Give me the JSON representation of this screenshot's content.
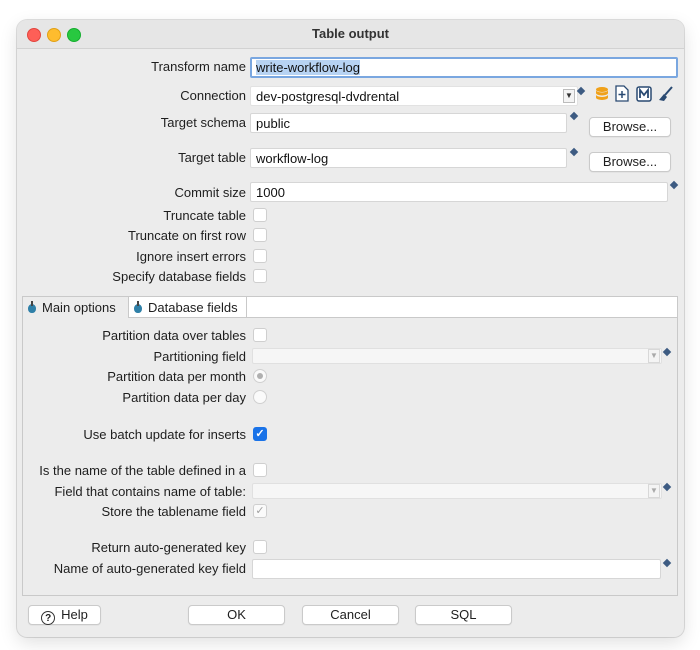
{
  "window": {
    "title": "Table output"
  },
  "top": {
    "transform_name": {
      "label": "Transform name",
      "value": "write-workflow-log"
    },
    "connection": {
      "label": "Connection",
      "value": "dev-postgresql-dvdrental"
    },
    "target_schema": {
      "label": "Target schema",
      "value": "public",
      "browse": "Browse..."
    },
    "target_table": {
      "label": "Target table",
      "value": "workflow-log",
      "browse": "Browse..."
    },
    "commit_size": {
      "label": "Commit size",
      "value": "1000"
    },
    "truncate_table": {
      "label": "Truncate table",
      "checked": false
    },
    "truncate_first_row": {
      "label": "Truncate on first row",
      "checked": false
    },
    "ignore_insert_errors": {
      "label": "Ignore insert errors",
      "checked": false
    },
    "specify_db_fields": {
      "label": "Specify database fields",
      "checked": false
    }
  },
  "tabs": [
    {
      "label": "Main options",
      "active": true
    },
    {
      "label": "Database fields",
      "active": false
    }
  ],
  "main_options": {
    "partition_over_tables": {
      "label": "Partition data over tables",
      "checked": false
    },
    "partitioning_field": {
      "label": "Partitioning field",
      "value": ""
    },
    "partition_per_month": {
      "label": "Partition data per month",
      "selected": true
    },
    "partition_per_day": {
      "label": "Partition data per day",
      "selected": false
    },
    "use_batch_update": {
      "label": "Use batch update for inserts",
      "checked": true
    },
    "table_name_in_field": {
      "label": "Is the name of the table defined in a",
      "checked": false
    },
    "field_with_table_name": {
      "label": "Field that contains name of table:",
      "value": ""
    },
    "store_tablename_field": {
      "label": "Store the tablename field",
      "checked": true
    },
    "return_auto_key": {
      "label": "Return auto-generated key",
      "checked": false
    },
    "auto_key_field_name": {
      "label": "Name of auto-generated key field",
      "value": ""
    }
  },
  "buttons": {
    "help": "Help",
    "ok": "OK",
    "cancel": "Cancel",
    "sql": "SQL"
  },
  "colors": {
    "accent": "#1a73e8",
    "selection": "#b7d3f3",
    "variable_diamond": "#3d5b82",
    "db_icon": "#f0a11a"
  }
}
